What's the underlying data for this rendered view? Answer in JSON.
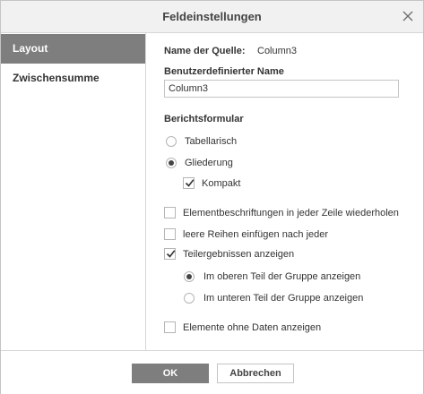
{
  "dialog": {
    "title": "Feldeinstellungen",
    "close_icon": "close-icon"
  },
  "sidebar": {
    "items": [
      {
        "label": "Layout",
        "active": true
      },
      {
        "label": "Zwischensumme",
        "active": false
      }
    ]
  },
  "layout": {
    "source_label": "Name der Quelle:",
    "source_value": "Column3",
    "custom_name_label": "Benutzerdefinierter Name",
    "custom_name_value": "Column3",
    "report_form_label": "Berichtsformular",
    "form_options": [
      {
        "label": "Tabellarisch",
        "selected": false
      },
      {
        "label": "Gliederung",
        "selected": true
      }
    ],
    "compact": {
      "label": "Kompakt",
      "checked": true
    },
    "repeat_labels": {
      "label": "Elementbeschriftungen in jeder Zeile wiederholen",
      "checked": false
    },
    "blank_rows": {
      "label": "leere Reihen einfügen nach jeder",
      "checked": false
    },
    "show_subtotals": {
      "label": "Teilergebnissen anzeigen",
      "checked": true
    },
    "subtotal_position": [
      {
        "label": "Im oberen Teil der Gruppe anzeigen",
        "selected": true
      },
      {
        "label": "Im unteren Teil der Gruppe anzeigen",
        "selected": false
      }
    ],
    "show_empty_items": {
      "label": "Elemente ohne Daten anzeigen",
      "checked": false
    }
  },
  "footer": {
    "ok_label": "OK",
    "cancel_label": "Abbrechen"
  },
  "colors": {
    "accent": "#7e7e7e",
    "title_bar": "#f1f1f1",
    "border": "#c4c4c4"
  }
}
